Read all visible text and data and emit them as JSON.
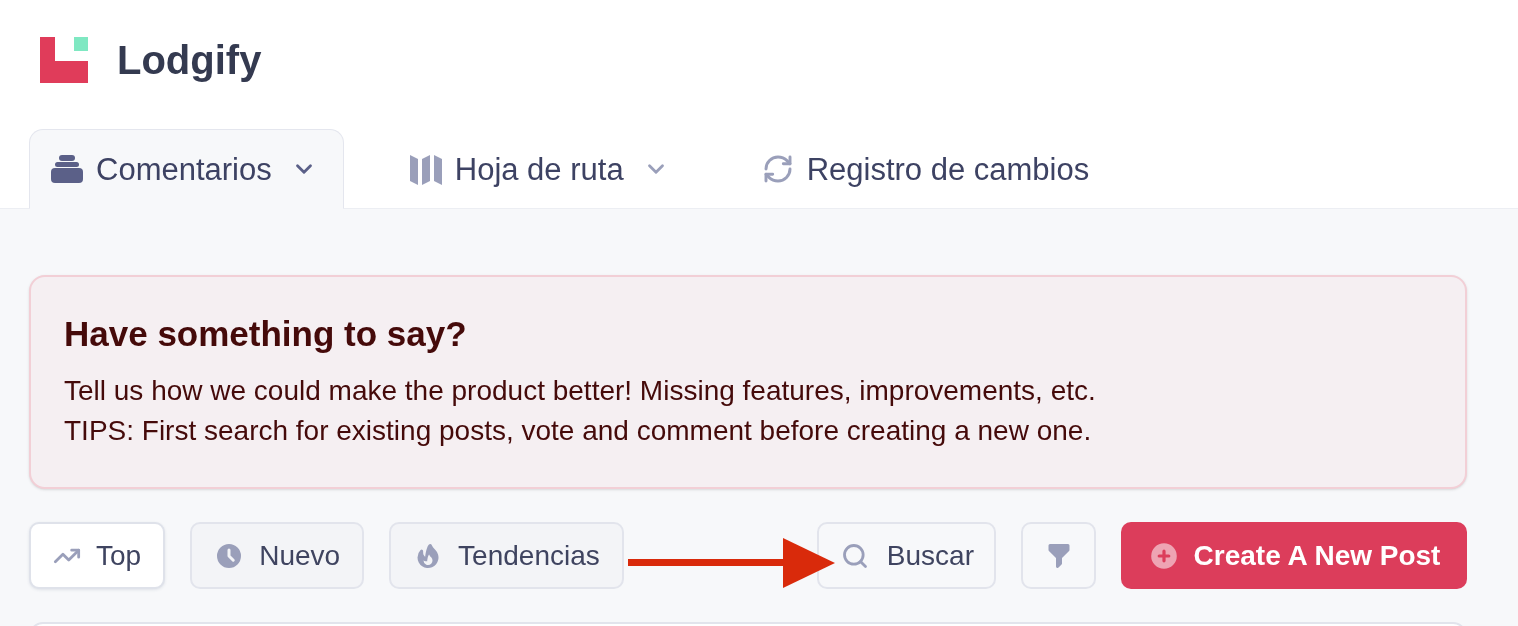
{
  "brand": {
    "name": "Lodgify"
  },
  "tabs": [
    {
      "label": "Comentarios",
      "dropdown": true,
      "selected": true
    },
    {
      "label": "Hoja de ruta",
      "dropdown": true,
      "selected": false
    },
    {
      "label": "Registro de cambios",
      "dropdown": false,
      "selected": false
    }
  ],
  "banner": {
    "title": "Have something to say?",
    "lines": [
      "Tell us how we could make the product better! Missing features, improvements, etc.",
      "TIPS: First search for existing posts, vote and comment before creating a new one."
    ]
  },
  "sort_buttons": [
    {
      "label": "Top",
      "selected": true
    },
    {
      "label": "Nuevo",
      "selected": false
    },
    {
      "label": "Tendencias",
      "selected": false
    }
  ],
  "search_button": {
    "label": "Buscar"
  },
  "create_button": {
    "label": "Create A New Post"
  }
}
